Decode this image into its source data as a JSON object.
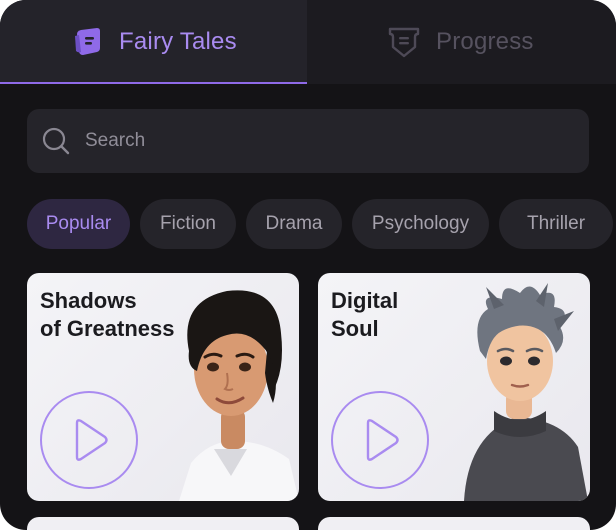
{
  "tabs": [
    {
      "label": "Fairy Tales",
      "icon": "book-icon",
      "active": true
    },
    {
      "label": "Progress",
      "icon": "badge-icon",
      "active": false
    }
  ],
  "search": {
    "placeholder": "Search",
    "icon": "search-icon"
  },
  "chips": [
    {
      "label": "Popular",
      "active": true
    },
    {
      "label": "Fiction",
      "active": false
    },
    {
      "label": "Drama",
      "active": false
    },
    {
      "label": "Psychology",
      "active": false
    },
    {
      "label": "Thriller",
      "active": false
    }
  ],
  "cards": [
    {
      "title_line1": "Shadows",
      "title_line2": "of Greatness",
      "icon": "play-icon"
    },
    {
      "title_line1": "Digital",
      "title_line2": "Soul",
      "icon": "play-icon"
    }
  ],
  "colors": {
    "accent": "#a98bf0",
    "background": "#141316",
    "surface": "#25242a",
    "card": "#f0eff3"
  }
}
